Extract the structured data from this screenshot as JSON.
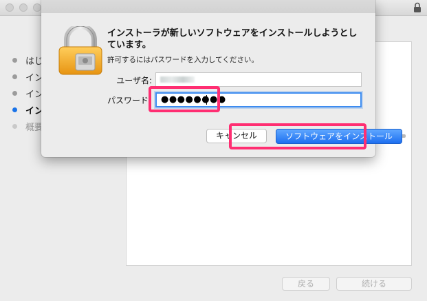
{
  "background_window": {
    "steps": [
      {
        "label": "はじ",
        "state": "done"
      },
      {
        "label": "イン",
        "state": "done"
      },
      {
        "label": "イン",
        "state": "done"
      },
      {
        "label": "イン",
        "state": "active"
      },
      {
        "label": "概要",
        "state": "pending"
      }
    ],
    "back_button": "戻る",
    "continue_button": "続ける"
  },
  "auth_dialog": {
    "headline": "インストーラが新しいソフトウェアをインストールしようとしています。",
    "subtext": "許可するにはパスワードを入力してください。",
    "username_label": "ユーザ名:",
    "password_label": "パスワード",
    "password_value": "●●●●●●●●",
    "cancel_button": "キャンセル",
    "install_button": "ソフトウェアをインストール"
  },
  "colors": {
    "accent_blue": "#1d6ff0",
    "highlight_pink": "#ff2e72",
    "active_step_dot": "#1a73e8"
  },
  "icons": {
    "dialog_icon": "padlock-icon",
    "titlebar_icon": "lock-icon"
  }
}
